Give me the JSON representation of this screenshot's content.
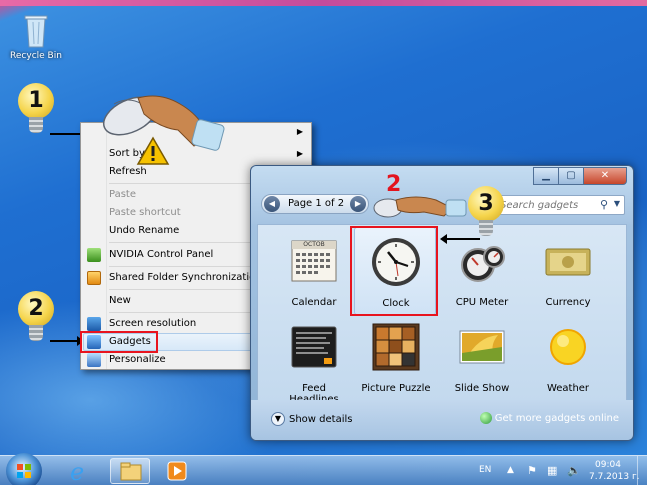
{
  "desktop": {
    "recycle_bin_label": "Recycle Bin"
  },
  "steps": {
    "step1": "1",
    "step2": "2",
    "step2_red": "2",
    "step3": "3"
  },
  "context_menu": {
    "items": [
      {
        "label": "Sort by",
        "disabled": false,
        "submenu": true
      },
      {
        "label": "Refresh",
        "disabled": false
      },
      {
        "label": "Paste",
        "disabled": true
      },
      {
        "label": "Paste shortcut",
        "disabled": true
      },
      {
        "label": "Undo Rename",
        "disabled": false
      },
      {
        "label": "NVIDIA Control Panel",
        "disabled": false
      },
      {
        "label": "Shared Folder Synchronization",
        "disabled": false,
        "submenu": true
      },
      {
        "label": "New",
        "disabled": false,
        "submenu": true
      },
      {
        "label": "Screen resolution",
        "disabled": false
      },
      {
        "label": "Gadgets",
        "disabled": false,
        "highlighted": true
      },
      {
        "label": "Personalize",
        "disabled": false
      }
    ]
  },
  "gadget_window": {
    "pager_text": "Page 1 of 2",
    "search_placeholder": "Search gadgets",
    "gadgets": [
      {
        "label": "Calendar"
      },
      {
        "label": "Clock",
        "selected": true
      },
      {
        "label": "CPU Meter"
      },
      {
        "label": "Currency"
      },
      {
        "label": "Feed Headlines"
      },
      {
        "label": "Picture Puzzle"
      },
      {
        "label": "Slide Show"
      },
      {
        "label": "Weather"
      }
    ],
    "calendar_month": "OCTOB",
    "show_details": "Show details",
    "get_more_online": "Get more gadgets online"
  },
  "taskbar": {
    "language": "EN",
    "time": "09:04",
    "date": "7.7.2013 г."
  },
  "colors": {
    "highlight_red": "#e8141e",
    "menu_bg": "#f0f0f0",
    "window_glass": "#a9c7e4"
  }
}
